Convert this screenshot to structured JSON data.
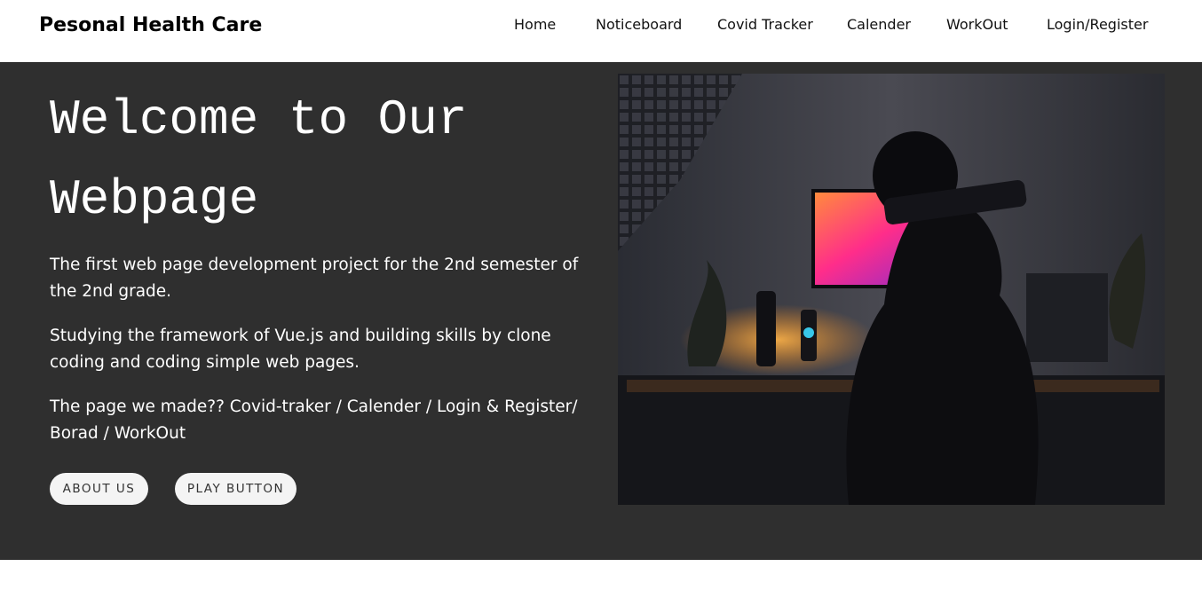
{
  "nav": {
    "brand": "Pesonal Health Care",
    "items": [
      {
        "label": "Home"
      },
      {
        "label": "Noticeboard"
      },
      {
        "label": "Covid Tracker"
      },
      {
        "label": "Calender"
      },
      {
        "label": "WorkOut"
      },
      {
        "label": "Login/Register"
      }
    ]
  },
  "hero": {
    "title_line1": "Welcome to Our",
    "title_line2": "Webpage",
    "paragraphs": [
      "The first web page development project for the 2nd semester of the 2nd grade.",
      "Studying the framework of Vue.js and building skills by clone coding and coding simple web pages.",
      "The page we made?? Covid-traker / Calender / Login & Register/ Borad / WorkOut"
    ],
    "buttons": {
      "about": "ABOUT US",
      "play": "PLAY BUTTON"
    }
  },
  "colors": {
    "hero_background": "#2f2f2f",
    "navbar_background": "#ffffff",
    "button_background": "#f4f4f4"
  }
}
